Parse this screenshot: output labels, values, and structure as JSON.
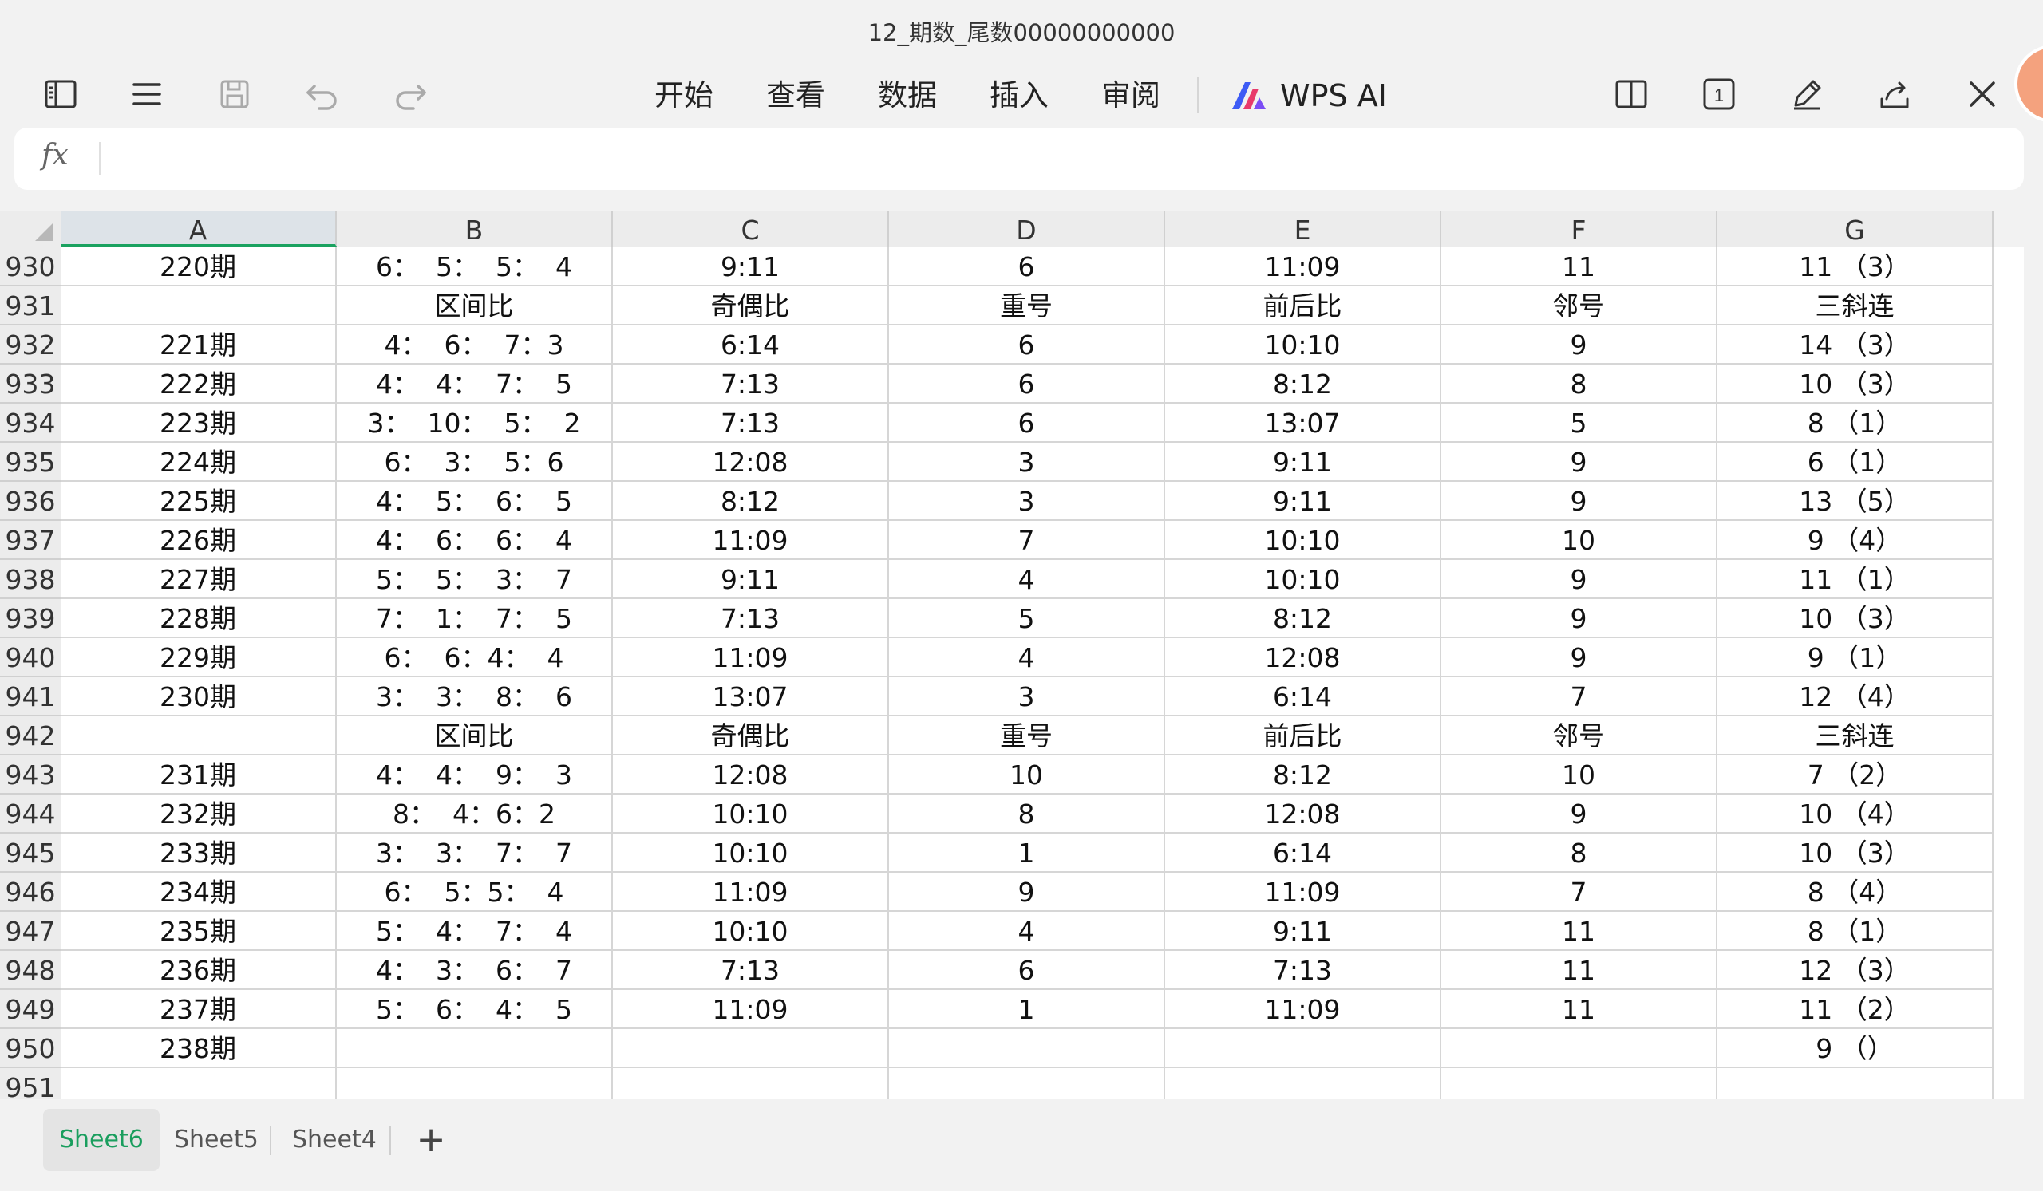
{
  "window": {
    "title": "12_期数_尾数00000000000"
  },
  "toolbar": {
    "menus": [
      "开始",
      "查看",
      "数据",
      "插入",
      "审阅"
    ],
    "ai_label": "WPS AI",
    "page_badge": "1"
  },
  "formula_bar": {
    "fx_label": "fx",
    "value": ""
  },
  "columns": [
    "A",
    "B",
    "C",
    "D",
    "E",
    "F",
    "G"
  ],
  "selected_column": "A",
  "rows": [
    {
      "num": "930",
      "cells": [
        "220期",
        "6：  5：  5：  4",
        "9:11",
        "6",
        "11:09",
        "11",
        "11 （3）"
      ]
    },
    {
      "num": "931",
      "cells": [
        "",
        "区间比",
        "奇偶比",
        "重号",
        "前后比",
        "邻号",
        "三斜连"
      ]
    },
    {
      "num": "932",
      "cells": [
        "221期",
        "4：  6：  7：3",
        "6:14",
        "6",
        "10:10",
        "9",
        "14 （3）"
      ]
    },
    {
      "num": "933",
      "cells": [
        "222期",
        "4：  4：  7：  5",
        "7:13",
        "6",
        "8:12",
        "8",
        "10 （3）"
      ]
    },
    {
      "num": "934",
      "cells": [
        "223期",
        "3：  10：  5：  2",
        "7:13",
        "6",
        "13:07",
        "5",
        "8 （1）"
      ]
    },
    {
      "num": "935",
      "cells": [
        "224期",
        "6：  3：  5：6",
        "12:08",
        "3",
        "9:11",
        "9",
        "6 （1）"
      ]
    },
    {
      "num": "936",
      "cells": [
        "225期",
        "4：  5：  6：  5",
        "8:12",
        "3",
        "9:11",
        "9",
        "13 （5）"
      ]
    },
    {
      "num": "937",
      "cells": [
        "226期",
        "4：  6：  6：  4",
        "11:09",
        "7",
        "10:10",
        "10",
        "9 （4）"
      ]
    },
    {
      "num": "938",
      "cells": [
        "227期",
        "5：  5：  3：  7",
        "9:11",
        "4",
        "10:10",
        "9",
        "11 （1）"
      ]
    },
    {
      "num": "939",
      "cells": [
        "228期",
        "7：  1：  7：  5",
        "7:13",
        "5",
        "8:12",
        "9",
        "10 （3）"
      ]
    },
    {
      "num": "940",
      "cells": [
        "229期",
        "6：  6：4：  4",
        "11:09",
        "4",
        "12:08",
        "9",
        "9 （1）"
      ]
    },
    {
      "num": "941",
      "cells": [
        "230期",
        "3：  3：  8：  6",
        "13:07",
        "3",
        "6:14",
        "7",
        "12 （4）"
      ]
    },
    {
      "num": "942",
      "cells": [
        "",
        "区间比",
        "奇偶比",
        "重号",
        "前后比",
        "邻号",
        "三斜连"
      ]
    },
    {
      "num": "943",
      "cells": [
        "231期",
        "4：  4：  9：  3",
        "12:08",
        "10",
        "8:12",
        "10",
        "7 （2）"
      ]
    },
    {
      "num": "944",
      "cells": [
        "232期",
        "8：  4：6：2",
        "10:10",
        "8",
        "12:08",
        "9",
        "10 （4）"
      ]
    },
    {
      "num": "945",
      "cells": [
        "233期",
        "3：  3：  7：  7",
        "10:10",
        "1",
        "6:14",
        "8",
        "10 （3）"
      ]
    },
    {
      "num": "946",
      "cells": [
        "234期",
        "6：  5：5：  4",
        "11:09",
        "9",
        "11:09",
        "7",
        "8 （4）"
      ]
    },
    {
      "num": "947",
      "cells": [
        "235期",
        "5：  4：  7：  4",
        "10:10",
        "4",
        "9:11",
        "11",
        "8 （1）"
      ]
    },
    {
      "num": "948",
      "cells": [
        "236期",
        "4：  3：  6：  7",
        "7:13",
        "6",
        "7:13",
        "11",
        "12 （3）"
      ]
    },
    {
      "num": "949",
      "cells": [
        "237期",
        "5：  6：  4：  5",
        "11:09",
        "1",
        "11:09",
        "11",
        "11 （2）"
      ]
    },
    {
      "num": "950",
      "cells": [
        "238期",
        "",
        "",
        "",
        "",
        "",
        "9 （）"
      ]
    },
    {
      "num": "951",
      "cells": [
        "",
        "",
        "",
        "",
        "",
        "",
        ""
      ]
    }
  ],
  "sheet_tabs": [
    "Sheet6",
    "Sheet5",
    "Sheet4"
  ],
  "active_sheet": "Sheet6",
  "add_sheet_label": "+",
  "colors": {
    "accent": "#1aa260",
    "header_bg": "#ececec",
    "grid_line": "#d6d6d6",
    "ai_brand": "#3d5bf5"
  }
}
